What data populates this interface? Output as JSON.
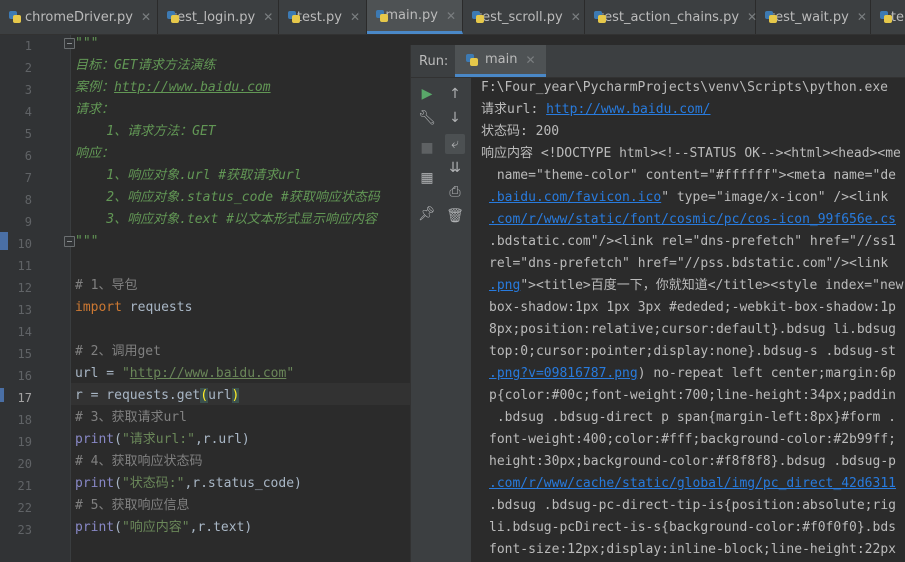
{
  "tabs": [
    {
      "label": "chromeDriver.py",
      "active": false
    },
    {
      "label": "test_login.py",
      "active": false
    },
    {
      "label": "test.py",
      "active": false
    },
    {
      "label": "main.py",
      "active": true
    },
    {
      "label": "test_scroll.py",
      "active": false
    },
    {
      "label": "test_action_chains.py",
      "active": false
    },
    {
      "label": "test_wait.py",
      "active": false
    },
    {
      "label": "te",
      "active": false
    }
  ],
  "editor": {
    "current_line": 17,
    "line_numbers": [
      "1",
      "2",
      "3",
      "4",
      "5",
      "6",
      "7",
      "8",
      "9",
      "10",
      "11",
      "12",
      "13",
      "14",
      "15",
      "16",
      "17",
      "18",
      "19",
      "20",
      "21",
      "22",
      "23"
    ],
    "code": {
      "l1": "\"\"\"",
      "l2": "目标：GET请求方法演练",
      "l3a": "案例：",
      "l3b": "http://www.baidu.com",
      "l4": "请求：",
      "l5": "    1、请求方法：GET",
      "l6": "响应：",
      "l7": "    1、响应对象.url #获取请求url",
      "l8": "    2、响应对象.status_code #获取响应状态码",
      "l9": "    3、响应对象.text #以文本形式显示响应内容",
      "l10": "\"\"\"",
      "l12": "# 1、导包",
      "l13kw": "import",
      "l13": " requests",
      "l15": "# 2、调用get",
      "l16a": "url = ",
      "l16q1": "\"",
      "l16link": "http://www.baidu.com",
      "l16q2": "\"",
      "l17a": "r = requests.get",
      "l17b": "(",
      "l17c": "url",
      "l17d": ")",
      "l18": "# 3、获取请求url",
      "l19fn": "print",
      "l19a": "(",
      "l19s": "\"请求url:\"",
      "l19b": ",r.url)",
      "l20": "# 4、获取响应状态码",
      "l21fn": "print",
      "l21a": "(",
      "l21s": "\"状态码:\"",
      "l21b": ",r.status_code)",
      "l22": "# 5、获取响应信息",
      "l23fn": "print",
      "l23a": "(",
      "l23s": "\"响应内容\"",
      "l23b": ",r.text)"
    }
  },
  "run": {
    "label": "Run:",
    "tab": "main",
    "output": {
      "o1": "F:\\Four_year\\PycharmProjects\\venv\\Scripts\\python.exe",
      "o2a": "请求url: ",
      "o2link": "http://www.baidu.com/",
      "o3": "状态码: 200",
      "o4": "响应内容 <!DOCTYPE html><!--STATUS OK--><html><head><me",
      "o5": " name=\"theme-color\" content=\"#ffffff\"><meta name=\"de",
      "o6link": ".baidu.com/favicon.ico",
      "o6": "\" type=\"image/x-icon\" /><link",
      "o7link": ".com/r/www/static/font/cosmic/pc/cos-icon_99f656e.cs",
      "o8": ".bdstatic.com\"/><link rel=\"dns-prefetch\" href=\"//ss1",
      "o9": "rel=\"dns-prefetch\" href=\"//pss.bdstatic.com\"/><link",
      "o10link": ".png",
      "o10": "\"><title>百度一下，你就知道</title><style index=\"new",
      "o11": "box-shadow:1px 1px 3px #ededed;-webkit-box-shadow:1p",
      "o12": "8px;position:relative;cursor:default}.bdsug li.bdsug",
      "o13": "top:0;cursor:pointer;display:none}.bdsug-s .bdsug-st",
      "o14link": ".png?v=09816787.png",
      "o14": ") no-repeat left center;margin:6p",
      "o15": "p{color:#00c;font-weight:700;line-height:34px;paddin",
      "o16": " .bdsug .bdsug-direct p span{margin-left:8px}#form .",
      "o17": "font-weight:400;color:#fff;background-color:#2b99ff;",
      "o18": "height:30px;background-color:#f8f8f8}.bdsug .bdsug-p",
      "o19link": ".com/r/www/cache/static/global/img/pc_direct_42d6311",
      "o20": ".bdsug .bdsug-pc-direct-tip-is{position:absolute;rig",
      "o21": "li.bdsug-pcDirect-is-s{background-color:#f0f0f0}.bds",
      "o22": "font-size:12px;display:inline-block;line-height:22px"
    }
  },
  "colors": {
    "accent": "#4a88c7",
    "docstring": "#629755",
    "keyword": "#cc7832",
    "string": "#6a8759",
    "comment": "#808080",
    "link": "#287bde"
  }
}
